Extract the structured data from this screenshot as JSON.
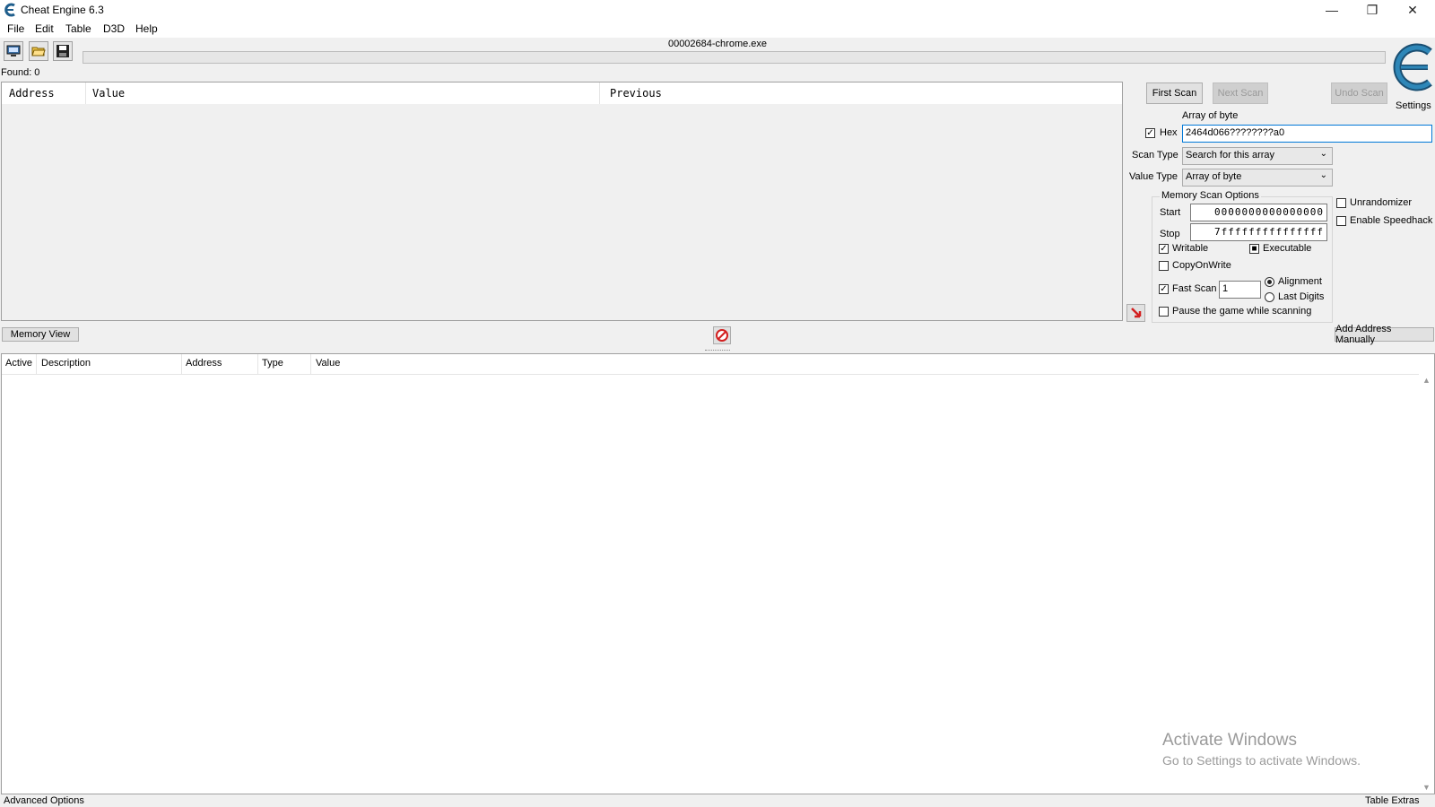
{
  "window": {
    "title": "Cheat Engine 6.3",
    "minimize_icon": "minimize-icon",
    "restore_icon": "restore-icon",
    "close_icon": "close-icon"
  },
  "menu": [
    "File",
    "Edit",
    "Table",
    "D3D",
    "Help"
  ],
  "toolbar": {
    "process_icon": "computer-process-icon",
    "open_icon": "open-folder-icon",
    "save_icon": "save-disk-icon",
    "process_name": "00002684-chrome.exe",
    "found": "Found: 0"
  },
  "results": {
    "columns": [
      "Address",
      "Value",
      "Previous"
    ]
  },
  "scan": {
    "first_scan": "First Scan",
    "next_scan": "Next Scan",
    "undo_scan": "Undo Scan",
    "settings": "Settings",
    "value_caption": "Array of byte",
    "hex_label": "Hex",
    "hex_checked": true,
    "value": "2464d066????????a0",
    "scan_type_label": "Scan Type",
    "scan_type": "Search for this array",
    "value_type_label": "Value Type",
    "value_type": "Array of byte"
  },
  "memory_options": {
    "title": "Memory Scan Options",
    "start_label": "Start",
    "start": "0000000000000000",
    "stop_label": "Stop",
    "stop": "7fffffffffffffff",
    "writable": "Writable",
    "executable": "Executable",
    "copy_on_write": "CopyOnWrite",
    "fast_scan": "Fast Scan",
    "fast_scan_value": "1",
    "alignment": "Alignment",
    "last_digits": "Last Digits",
    "pause": "Pause the game while scanning"
  },
  "extras": {
    "unrandomizer": "Unrandomizer",
    "speedhack": "Enable Speedhack"
  },
  "actions": {
    "memory_view": "Memory View",
    "add_address": "Add Address Manually",
    "stop_icon": "stop-sign-icon",
    "pointer_icon": "red-arrow-icon"
  },
  "address_list": {
    "columns": [
      "Active",
      "Description",
      "Address",
      "Type",
      "Value"
    ]
  },
  "watermark": {
    "line1": "Activate Windows",
    "line2": "Go to Settings to activate Windows."
  },
  "footer": {
    "advanced": "Advanced Options",
    "table_extras": "Table Extras"
  },
  "colors": {
    "accent_blue": "#0078d7",
    "logo_blue": "#2e87b8",
    "stop_red": "#d31f1f"
  }
}
